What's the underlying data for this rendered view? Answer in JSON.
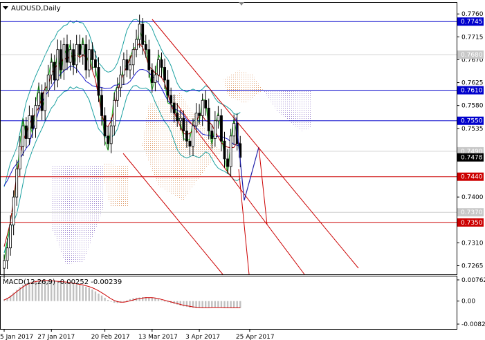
{
  "header": {
    "symbol_label": "AUDUSD,Daily",
    "macd_label": "MACD(12,26,9) -0.00252 -0.00239"
  },
  "colors": {
    "candle": "#000000",
    "level_blue": "#0000cc",
    "level_red": "#cc0000",
    "channel_red": "#cc0000",
    "forecast_blue": "#2020aa",
    "kumo_orange": "#e0a070",
    "kumo_violet": "#a08ad0",
    "bollinger": "#1aa0a0",
    "envelope_green": "#22cc22",
    "kijun": "#1a1acc",
    "tenkan": "#aa0000",
    "macd_hist": "#c0c0c0",
    "macd_signal": "#cc0000",
    "tag_bg_blue": "#0000cc",
    "tag_bg_red": "#cc0000",
    "tag_bg_black": "#000000",
    "tag_bg_grey": "#c8c8c8"
  },
  "chart_data": {
    "type": "candlestick",
    "price_axis": {
      "ylim": [
        0.7248,
        0.7782
      ],
      "ticks": [
        "0.7760",
        "0.7715",
        "0.7670",
        "0.7625",
        "0.7580",
        "0.7535",
        "0.7490",
        "0.7400",
        "0.7310",
        "0.7265"
      ],
      "tick_values": [
        0.776,
        0.7715,
        0.767,
        0.7625,
        0.758,
        0.7535,
        0.749,
        0.74,
        0.731,
        0.7265
      ]
    },
    "date_axis": {
      "labels": [
        "5 Jan 2017",
        "27 Jan 2017",
        "20 Feb 2017",
        "13 Mar 2017",
        "3 Apr 2017",
        "25 Apr 2017"
      ],
      "label_index": [
        0,
        15,
        32,
        47,
        62,
        78
      ]
    },
    "current_price": "0.7478",
    "levels": [
      {
        "value": 0.7745,
        "label": "0.7745",
        "color": "blue"
      },
      {
        "value": 0.768,
        "label": "0.7680",
        "color": "grey"
      },
      {
        "value": 0.761,
        "label": "0.7610",
        "color": "blue"
      },
      {
        "value": 0.755,
        "label": "0.7550",
        "color": "blue"
      },
      {
        "value": 0.749,
        "label": "0.7490",
        "color": "grey"
      },
      {
        "value": 0.744,
        "label": "0.7440",
        "color": "red"
      },
      {
        "value": 0.737,
        "label": "0.7370",
        "color": "grey"
      },
      {
        "value": 0.735,
        "label": "0.7350",
        "color": "red"
      }
    ],
    "closes": [
      0.7275,
      0.73,
      0.7345,
      0.74,
      0.7455,
      0.75,
      0.754,
      0.7515,
      0.756,
      0.7535,
      0.758,
      0.7605,
      0.757,
      0.761,
      0.764,
      0.7665,
      0.763,
      0.769,
      0.765,
      0.77,
      0.7665,
      0.769,
      0.766,
      0.77,
      0.768,
      0.77,
      0.765,
      0.769,
      0.767,
      0.7655,
      0.76,
      0.756,
      0.752,
      0.7505,
      0.754,
      0.759,
      0.7615,
      0.764,
      0.767,
      0.765,
      0.766,
      0.769,
      0.771,
      0.774,
      0.77,
      0.769,
      0.765,
      0.7625,
      0.764,
      0.767,
      0.7655,
      0.763,
      0.76,
      0.7585,
      0.7565,
      0.755,
      0.7555,
      0.753,
      0.751,
      0.75,
      0.754,
      0.7565,
      0.756,
      0.759,
      0.7575,
      0.753,
      0.7515,
      0.755,
      0.756,
      0.751,
      0.7475,
      0.746,
      0.752,
      0.7545,
      0.7505,
      0.7478
    ],
    "macd": {
      "axis_ticks": [
        "0.00762",
        "0.00",
        "-0.00828"
      ],
      "axis_values": [
        0.00762,
        0.0,
        -0.00828
      ],
      "histogram": [
        0.0006,
        0.0012,
        0.002,
        0.003,
        0.004,
        0.005,
        0.0058,
        0.0064,
        0.0068,
        0.0071,
        0.0073,
        0.0074,
        0.0074,
        0.0074,
        0.0073,
        0.0072,
        0.0071,
        0.007,
        0.0068,
        0.0067,
        0.0066,
        0.0064,
        0.0062,
        0.006,
        0.0058,
        0.0055,
        0.0052,
        0.0048,
        0.0042,
        0.0035,
        0.0027,
        0.002,
        0.0012,
        0.0004,
        -0.0002,
        -0.0006,
        -0.0007,
        -0.0005,
        -0.0001,
        0.0003,
        0.0007,
        0.001,
        0.0012,
        0.0013,
        0.0014,
        0.0014,
        0.0013,
        0.0012,
        0.001,
        0.0007,
        0.0003,
        -0.0001,
        -0.0004,
        -0.0007,
        -0.001,
        -0.0013,
        -0.0016,
        -0.0019,
        -0.0021,
        -0.0023,
        -0.0024,
        -0.0025,
        -0.0025,
        -0.0025,
        -0.0024,
        -0.0023,
        -0.0022,
        -0.0022,
        -0.0023,
        -0.0024,
        -0.0025,
        -0.0025,
        -0.0025,
        -0.0025,
        -0.0025,
        -0.0025
      ],
      "signal": [
        0.0004,
        0.0009,
        0.0016,
        0.0025,
        0.0034,
        0.0043,
        0.0051,
        0.0058,
        0.0063,
        0.0067,
        0.007,
        0.0072,
        0.0073,
        0.0074,
        0.0074,
        0.0073,
        0.0072,
        0.0071,
        0.007,
        0.0069,
        0.0068,
        0.0066,
        0.0064,
        0.0062,
        0.006,
        0.0058,
        0.0055,
        0.0052,
        0.0048,
        0.0043,
        0.0037,
        0.003,
        0.0023,
        0.0015,
        0.0008,
        0.0002,
        -0.0002,
        -0.0004,
        -0.0004,
        -0.0002,
        0.0001,
        0.0004,
        0.0007,
        0.0009,
        0.0011,
        0.0012,
        0.0012,
        0.0012,
        0.0011,
        0.0009,
        0.0006,
        0.0003,
        0.0,
        -0.0003,
        -0.0006,
        -0.0009,
        -0.0012,
        -0.0015,
        -0.0017,
        -0.0019,
        -0.0021,
        -0.0022,
        -0.0023,
        -0.0024,
        -0.0024,
        -0.0024,
        -0.0023,
        -0.0023,
        -0.0023,
        -0.0023,
        -0.0024,
        -0.0024,
        -0.0024,
        -0.0024,
        -0.0024,
        -0.0024
      ]
    }
  }
}
